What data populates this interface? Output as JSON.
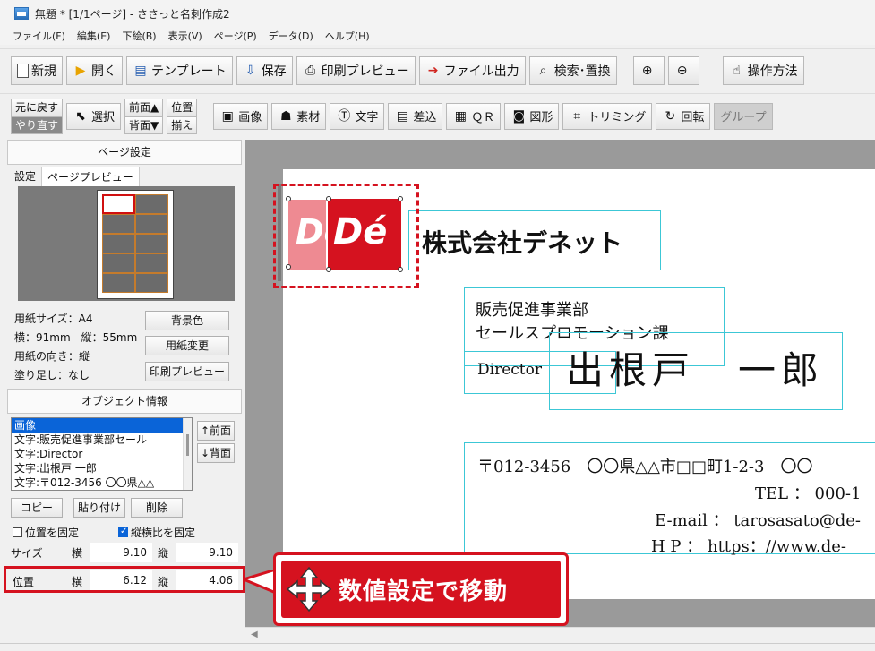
{
  "window": {
    "title": "無題 * [1/1ページ] - ささっと名刺作成2"
  },
  "menu": [
    "ファイル(F)",
    "編集(E)",
    "下絵(B)",
    "表示(V)",
    "ページ(P)",
    "データ(D)",
    "ヘルプ(H)"
  ],
  "toolbar1": {
    "new": "新規",
    "open": "開く",
    "template": "テンプレート",
    "save": "保存",
    "print_preview": "印刷プレビュー",
    "file_output": "ファイル出力",
    "search_replace": "検索･置換",
    "zoom_in": "⊕",
    "zoom_out": "⊖",
    "howto": "操作方法"
  },
  "toolbar2": {
    "undo": "元に戻す",
    "redo": "やり直す",
    "select": "選択",
    "front": "前面▲",
    "back": "背面▼",
    "align_top": "位置",
    "align_bottom": "揃え",
    "image": "画像",
    "material": "素材",
    "text": "文字",
    "merge": "差込",
    "qr": "ＱＲ",
    "shape": "図形",
    "trim": "トリミング",
    "rotate": "回転",
    "group": "グループ"
  },
  "page_settings": {
    "header": "ページ設定",
    "tabs": [
      "設定",
      "ページプレビュー"
    ],
    "paper_size": "用紙サイズ：A4",
    "dimensions": "横：91mm　縦：55mm",
    "orientation": "用紙の向き：縦",
    "bleed": "塗り足し：なし",
    "bg_color_btn": "背景色",
    "change_paper_btn": "用紙変更",
    "print_preview_btn": "印刷プレビュー"
  },
  "object_info": {
    "header": "オブジェクト情報",
    "list": [
      "画像",
      "文字:販売促進事業部セール",
      "文字:Director",
      "文字:出根戸 一郎",
      "文字:〒012-3456 〇〇県△△"
    ],
    "front_btn": "↑前面",
    "back_btn": "↓背面",
    "copy_btn": "コピー",
    "paste_btn": "貼り付け",
    "delete_btn": "削除",
    "lock_position": "位置を固定",
    "lock_aspect": "縦横比を固定",
    "size_label": "サイズ",
    "pos_label": "位置",
    "h_label": "横",
    "v_label": "縦",
    "size_h": "9.10",
    "size_v": "9.10",
    "pos_h": "6.12",
    "pos_v": "4.06"
  },
  "card": {
    "logo_text": "Dé",
    "company": "株式会社デネット",
    "dept1": "販売促進事業部",
    "dept2": "セールスプロモーション課",
    "title": "Director",
    "name": "出根戸　一郎",
    "address": "〒012-3456　〇〇県△△市□□町1-2-3　〇〇",
    "tel": "TEL ： 000-1",
    "email": "E-mail ： tarosasato@de-",
    "hp": "H P ： https：//www.de-"
  },
  "callout": {
    "text": "数値設定で移動"
  },
  "colors": {
    "accent": "#d5121f",
    "frame": "#3cc7d6",
    "selection": "#0a64d8"
  }
}
